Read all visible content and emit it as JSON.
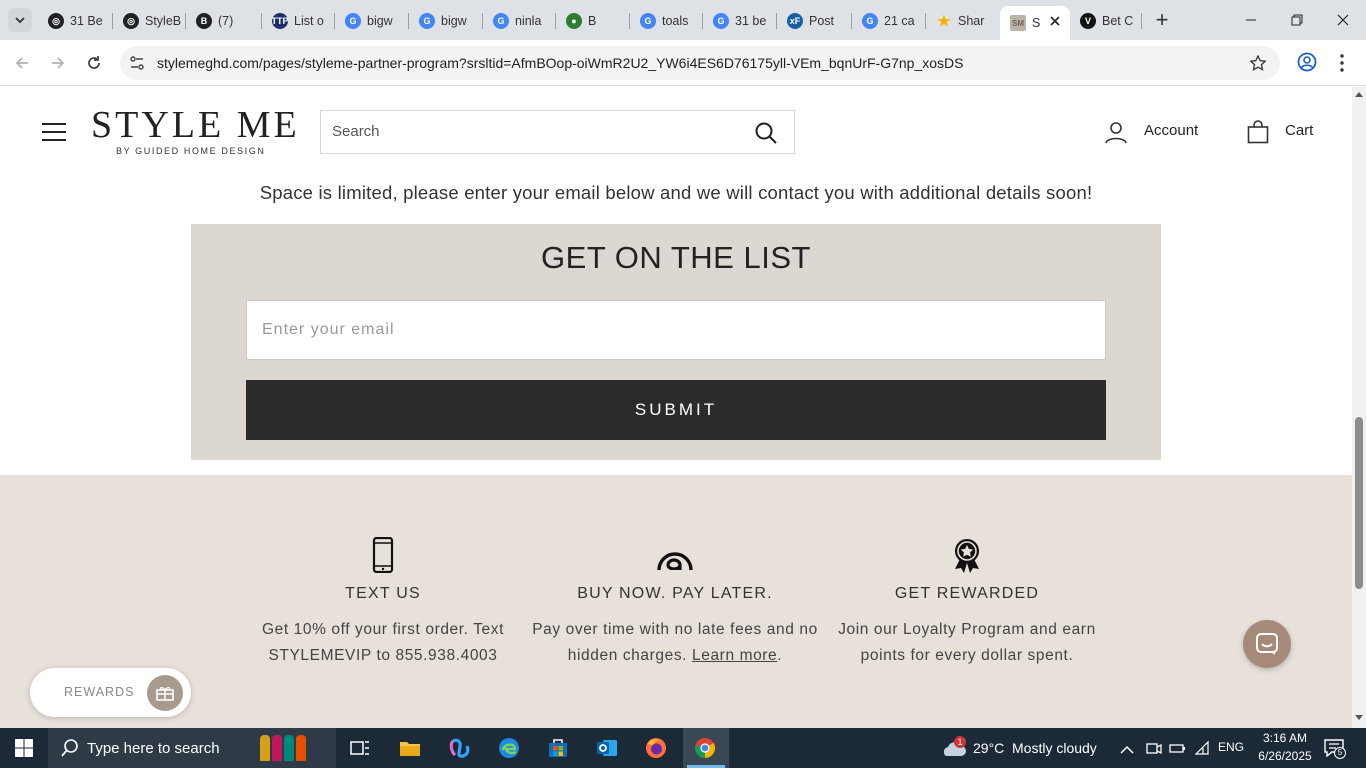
{
  "browser": {
    "tabs": [
      {
        "title": "31 Be",
        "color": "#202124",
        "glyph": "◎"
      },
      {
        "title": "StyleB",
        "color": "#202124",
        "glyph": "◎"
      },
      {
        "title": "(7)",
        "color": "#202124",
        "glyph": "B"
      },
      {
        "title": "List o",
        "color": "#1a2f6b",
        "glyph": "TTP"
      },
      {
        "title": "bigw",
        "color": "#4285f4",
        "glyph": "G"
      },
      {
        "title": "bigw",
        "color": "#4285f4",
        "glyph": "G"
      },
      {
        "title": "ninla",
        "color": "#4285f4",
        "glyph": "G"
      },
      {
        "title": "B",
        "color": "#2e7d32",
        "glyph": "●"
      },
      {
        "title": "toals",
        "color": "#4285f4",
        "glyph": "G"
      },
      {
        "title": "31 be",
        "color": "#4285f4",
        "glyph": "G"
      },
      {
        "title": "Post",
        "color": "#185fa8",
        "glyph": "xF"
      },
      {
        "title": "21 ca",
        "color": "#4285f4",
        "glyph": "G"
      },
      {
        "title": "Shar",
        "color": "#f4b400",
        "glyph": "★"
      },
      {
        "title": "S",
        "color": "#bdb3a9",
        "glyph": "SM"
      },
      {
        "title": "Bet C",
        "color": "#111111",
        "glyph": "V"
      }
    ],
    "new_tab_label": "+",
    "url": "stylemeghd.com/pages/styleme-partner-program?srsltid=AfmBOop-oiWmR2U2_YW6i4ES6D76175yll-VEm_bqnUrF-G7np_xosDS"
  },
  "site": {
    "logo_main": "STYLE ME",
    "logo_sub": "BY GUIDED HOME DESIGN",
    "search_placeholder": "Search",
    "account_label": "Account",
    "cart_label": "Cart"
  },
  "page": {
    "notice": "Space is limited, please enter your email below and we will contact you with additional details soon!",
    "signup_title": "GET ON THE LIST",
    "email_placeholder": "Enter your email",
    "submit_label": "SUBMIT",
    "features": [
      {
        "icon": "phone-icon",
        "title": "TEXT US",
        "text": "Get 10% off your first order. Text STYLEMEVIP to 855.938.4003"
      },
      {
        "icon": "at-sign-icon",
        "title": "BUY NOW. PAY LATER.",
        "text": "Pay over time with no late fees and no hidden charges.",
        "link": "Learn more",
        "after": "."
      },
      {
        "icon": "award-ribbon-icon",
        "title": "GET REWARDED",
        "text": "Join our Loyalty Program and earn points for every dollar spent."
      }
    ],
    "rewards_label": "REWARDS"
  },
  "taskbar": {
    "search_placeholder": "Type here to search",
    "weather_temp": "29°C",
    "weather_text": "Mostly cloudy",
    "weather_badge": "1",
    "language": "ENG",
    "time": "3:16 AM",
    "date": "6/26/2025",
    "notification_count": "5"
  },
  "colors": {
    "signup_bg": "#dcd7d1",
    "features_bg": "#e7e1da",
    "submit_bg": "#2b2b2b",
    "chat_bg": "#a58a79"
  }
}
